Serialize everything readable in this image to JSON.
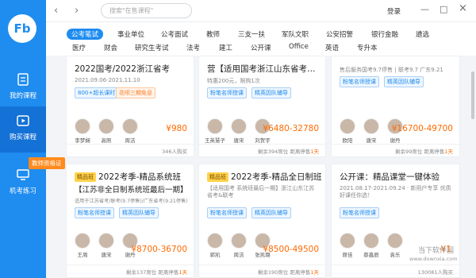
{
  "app": {
    "logo": "Fb"
  },
  "sidebar": {
    "items": [
      {
        "label": "我的课程",
        "icon": "document-icon"
      },
      {
        "label": "购买课程",
        "icon": "play-icon"
      },
      {
        "label": "机考练习",
        "icon": "computer-icon"
      }
    ],
    "badge": "教师资格证"
  },
  "topbar": {
    "back": "‹",
    "forward": "›",
    "search_placeholder": "搜索\"在售课程\"",
    "login": "登录",
    "minimize": "—",
    "maximize": "□",
    "close": "×"
  },
  "tabs": {
    "row1": [
      "公考笔试",
      "事业单位",
      "公考面试",
      "教师",
      "三支一扶",
      "军队文职",
      "公安招警",
      "银行金融",
      "遴选"
    ],
    "row2": [
      "医疗",
      "财会",
      "研究生考试",
      "法考",
      "建工",
      "公开课",
      "Office",
      "英语",
      "专升本"
    ]
  },
  "cards": [
    {
      "title": "2022国考/2022浙江省考",
      "dates": "2021.09.06-2021.11.10",
      "tags": [
        "800+超长课时",
        "花呗三期免息"
      ],
      "teachers": [
        "李梦娴",
        "高照",
        "周洁"
      ],
      "price": "¥980",
      "foot": "346人购买"
    },
    {
      "title": "营【适用国考浙江山东省考四川下...",
      "dates": "特惠200元，限购1次",
      "tags": [
        "粉笔名师授课",
        "精英因队辅导"
      ],
      "teachers": [
        "王英慧子",
        "唐宋",
        "刘贺宇"
      ],
      "price": "¥6480-32780",
      "foot_pre": "剩余394席位 距离停售",
      "foot_hot": "1天"
    },
    {
      "title": "",
      "dates": "售后服务国考9.7停售 | 联考9.7 广东9.21",
      "tags": [
        "粉笔名师授课",
        "精英因队辅导"
      ],
      "teachers": [
        "欧阳",
        "唐宋",
        "谢丹"
      ],
      "price": "¥16700-49700",
      "foot_pre": "剩余99席位 距离停售",
      "foot_hot": "1天"
    },
    {
      "premium": "精品班",
      "title": "2022考季-精品系统班",
      "title2": "【江苏非全日制系统班最后一期】",
      "dates": "适用于江苏省考/联考(9.7停售)/广东省考(9.21停售)",
      "tags": [
        "粉笔名师授课",
        "精英因队辅导"
      ],
      "teachers": [
        "王周",
        "唐宋",
        "谢丹"
      ],
      "price": "¥8700-36700",
      "foot_pre": "剩余137席位 距离停售",
      "foot_hot": "1天"
    },
    {
      "premium": "精品班",
      "title": "2022考季-精品全日制班",
      "title2": "【适用国考 系统班最后一期】浙江山东江苏省考&联考",
      "tags": [
        "粉笔名师授课",
        "精英因队辅导"
      ],
      "teachers": [
        "郭凯",
        "周洁",
        "张凯璐"
      ],
      "price": "¥8500-49500",
      "foot_pre": "剩余190席位 距离停售",
      "foot_hot": "1天"
    },
    {
      "title": "公开课：精品课堂一键体验",
      "dates": "2021.08.17-2021.09.24 · 新用户专享 优质好课任你选！",
      "tags": [
        "粉笔名师授课"
      ],
      "teachers": [
        "原佳",
        "蔡鑫辰",
        "袁乐"
      ],
      "price": "¥1",
      "foot": "130081人购买"
    }
  ],
  "watermark": {
    "text": "当下软件园",
    "url": "www.downxia.com"
  },
  "colors": {
    "primary": "#1f8cf0",
    "price": "#ff6a00",
    "badge": "#ff8a1e"
  }
}
